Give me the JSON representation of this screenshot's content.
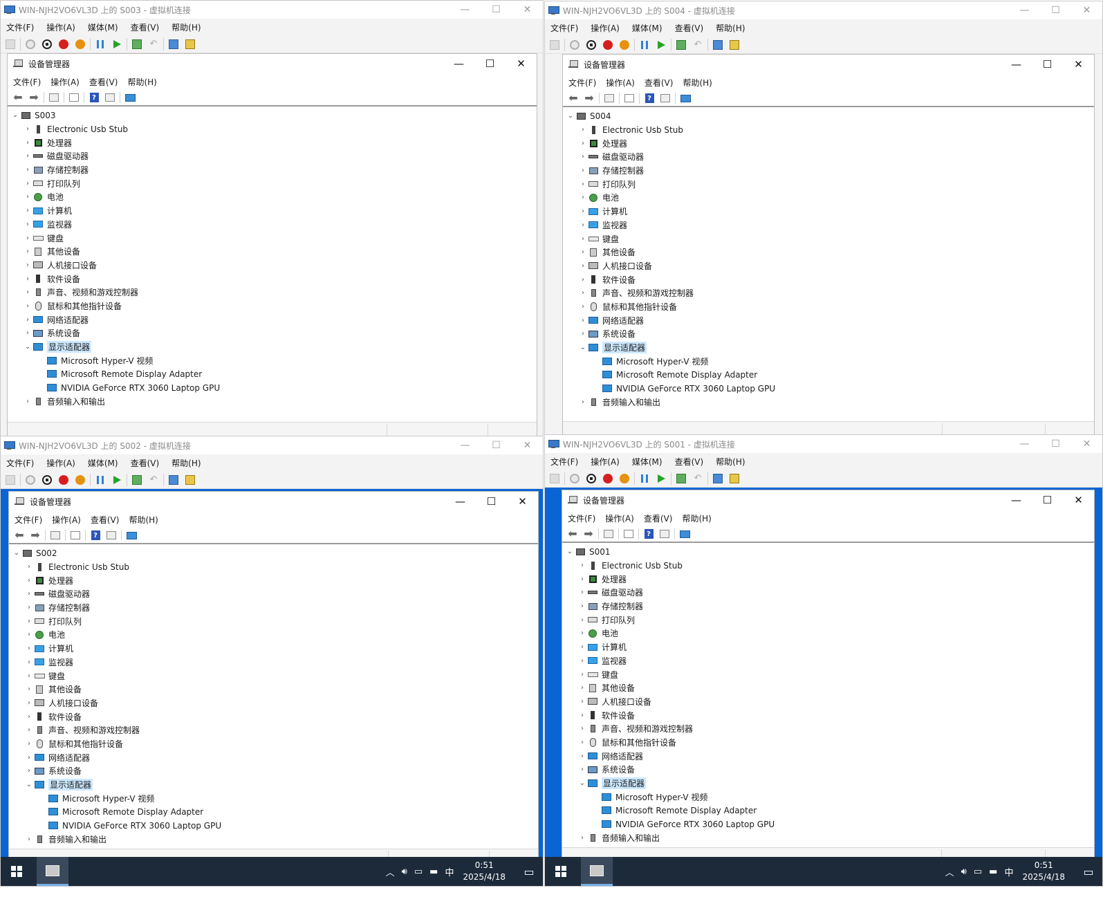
{
  "vm_common": {
    "menu": [
      "文件(F)",
      "操作(A)",
      "媒体(M)",
      "查看(V)",
      "帮助(H)"
    ]
  },
  "dm_common": {
    "title": "设备管理器",
    "menu": [
      "文件(F)",
      "操作(A)",
      "查看(V)",
      "帮助(H)"
    ],
    "categories": [
      {
        "label": "Electronic Usb Stub",
        "icon": "usb-icon"
      },
      {
        "label": "处理器",
        "icon": "cpu-icon"
      },
      {
        "label": "磁盘驱动器",
        "icon": "disk-icon"
      },
      {
        "label": "存储控制器",
        "icon": "storage-controller-icon"
      },
      {
        "label": "打印队列",
        "icon": "printer-icon"
      },
      {
        "label": "电池",
        "icon": "battery-icon"
      },
      {
        "label": "计算机",
        "icon": "computer-icon"
      },
      {
        "label": "监视器",
        "icon": "monitor-icon"
      },
      {
        "label": "键盘",
        "icon": "keyboard-icon"
      },
      {
        "label": "其他设备",
        "icon": "unknown-device-icon"
      },
      {
        "label": "人机接口设备",
        "icon": "hid-icon"
      },
      {
        "label": "软件设备",
        "icon": "software-device-icon"
      },
      {
        "label": "声音、视频和游戏控制器",
        "icon": "speaker-icon"
      },
      {
        "label": "鼠标和其他指针设备",
        "icon": "mouse-icon"
      },
      {
        "label": "网络适配器",
        "icon": "network-icon"
      },
      {
        "label": "系统设备",
        "icon": "system-icon"
      },
      {
        "label": "显示适配器",
        "icon": "display-adapter-icon",
        "expanded": true
      }
    ],
    "display_children": [
      "Microsoft Hyper-V 视频",
      "Microsoft Remote Display Adapter",
      "NVIDIA GeForce RTX 3060 Laptop GPU"
    ],
    "last_category": {
      "label": "音频输入和输出",
      "icon": "audio-io-icon"
    }
  },
  "windows": [
    {
      "id": "s003",
      "vm_title": "WIN-NJH2VO6VL3D 上的 S003 - 虚拟机连接",
      "host": "S003"
    },
    {
      "id": "s004",
      "vm_title": "WIN-NJH2VO6VL3D 上的 S004 - 虚拟机连接",
      "host": "S004"
    },
    {
      "id": "s002",
      "vm_title": "WIN-NJH2VO6VL3D 上的 S002 - 虚拟机连接",
      "host": "S002"
    },
    {
      "id": "s001",
      "vm_title": "WIN-NJH2VO6VL3D 上的 S001 - 虚拟机连接",
      "host": "S001"
    }
  ],
  "taskbar": {
    "ime": "中",
    "time": "0:51",
    "date": "2025/4/18"
  },
  "colors": {
    "selection": "#cce8ff",
    "desktop_blue": "#0a64d4",
    "taskbar": "#1d2a3a"
  }
}
